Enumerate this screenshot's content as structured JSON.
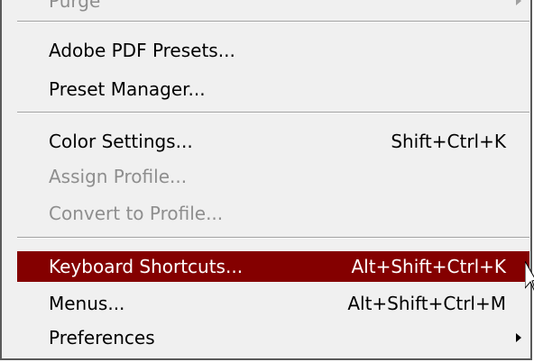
{
  "menu": {
    "items": [
      {
        "label": "Purge",
        "shortcut": "",
        "state": "disabled",
        "submenu": true
      },
      {
        "label": "Adobe PDF Presets...",
        "shortcut": "",
        "state": "normal"
      },
      {
        "label": "Preset Manager...",
        "shortcut": "",
        "state": "normal"
      },
      {
        "label": "Color Settings...",
        "shortcut": "Shift+Ctrl+K",
        "state": "normal"
      },
      {
        "label": "Assign Profile...",
        "shortcut": "",
        "state": "disabled"
      },
      {
        "label": "Convert to Profile...",
        "shortcut": "",
        "state": "disabled"
      },
      {
        "label": "Keyboard Shortcuts...",
        "shortcut": "Alt+Shift+Ctrl+K",
        "state": "highlighted"
      },
      {
        "label": "Menus...",
        "shortcut": "Alt+Shift+Ctrl+M",
        "state": "normal"
      },
      {
        "label": "Preferences",
        "shortcut": "",
        "state": "normal",
        "submenu": true
      }
    ]
  },
  "colors": {
    "highlight_bg": "#840000",
    "menu_bg": "#f0f0f0",
    "disabled_text": "#8e8e8e"
  },
  "icons": {
    "submenu": "chevron-right-icon",
    "cursor": "mouse-pointer-icon"
  }
}
